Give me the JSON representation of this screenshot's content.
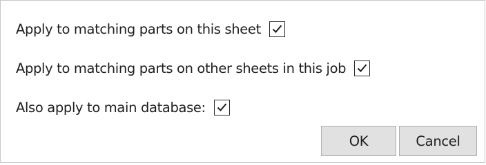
{
  "dialog": {
    "options": [
      {
        "label": "Apply to matching parts on this sheet",
        "checked": true
      },
      {
        "label": "Apply to matching parts on other sheets in this job",
        "checked": true
      },
      {
        "label": "Also apply to main database:",
        "checked": true
      }
    ],
    "buttons": {
      "ok_label": "OK",
      "cancel_label": "Cancel"
    }
  }
}
